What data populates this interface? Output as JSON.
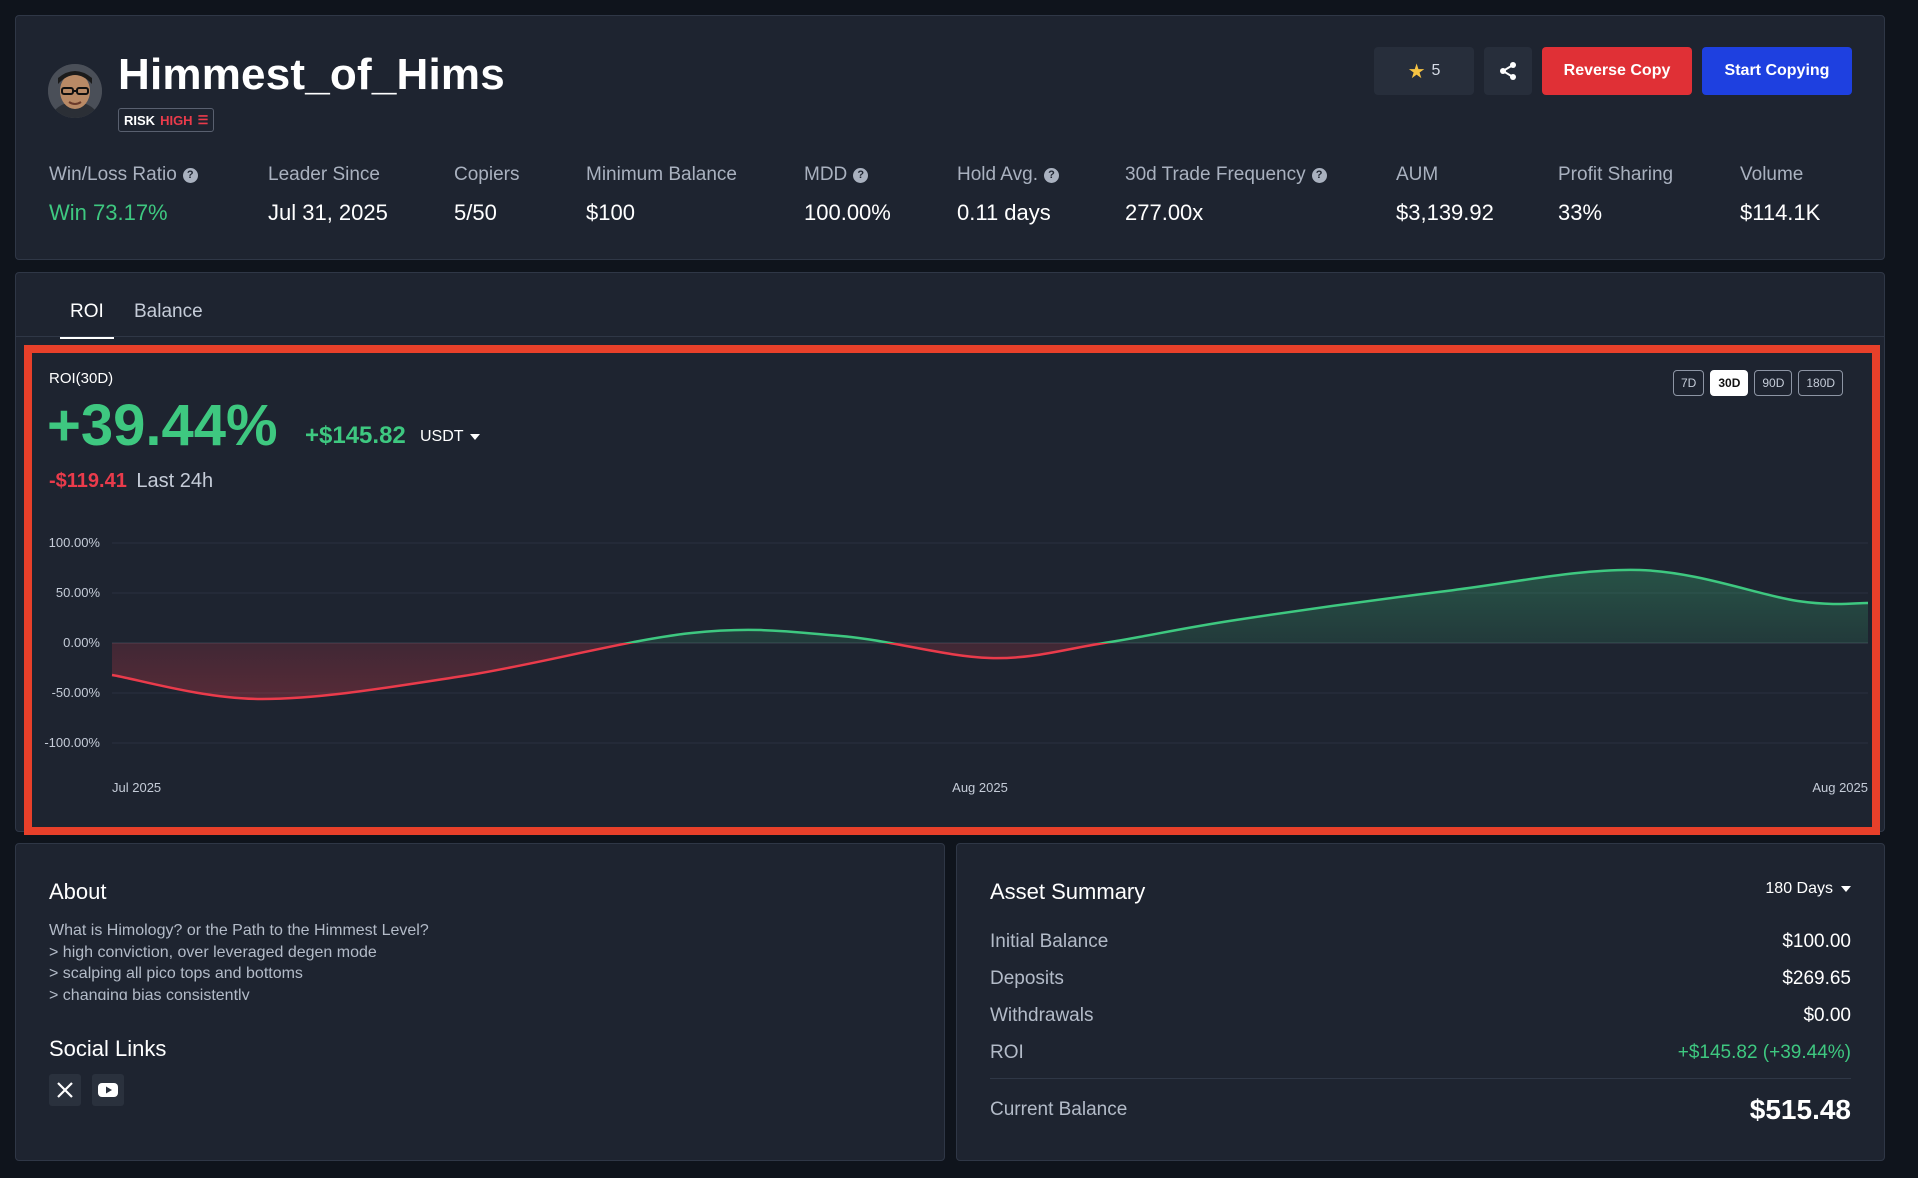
{
  "header": {
    "name": "Himmest_of_Hims",
    "risk_label": "RISK",
    "risk_level": "HIGH",
    "favorites_count": "5",
    "reverse_copy_label": "Reverse Copy",
    "start_copying_label": "Start Copying"
  },
  "stats": [
    {
      "label": "Win/Loss Ratio",
      "value": "Win 73.17%"
    },
    {
      "label": "Leader Since",
      "value": "Jul 31, 2025"
    },
    {
      "label": "Copiers",
      "value": "5/50"
    },
    {
      "label": "Minimum Balance",
      "value": "$100"
    },
    {
      "label": "MDD",
      "value": "100.00%"
    },
    {
      "label": "Hold Avg.",
      "value": "0.11 days"
    },
    {
      "label": "30d Trade Frequency",
      "value": "277.00x"
    },
    {
      "label": "AUM",
      "value": "$3,139.92"
    },
    {
      "label": "Profit Sharing",
      "value": "33%"
    },
    {
      "label": "Volume",
      "value": "$114.1K"
    }
  ],
  "tabs": [
    {
      "label": "ROI",
      "active": true
    },
    {
      "label": "Balance",
      "active": false
    }
  ],
  "roi": {
    "title": "ROI(30D)",
    "percent": "+39.44%",
    "amount": "+$145.82",
    "currency": "USDT",
    "day_change": "-$119.41",
    "day_change_label": "Last 24h",
    "ranges": [
      "7D",
      "30D",
      "90D",
      "180D"
    ],
    "active_range": "30D"
  },
  "chart_data": {
    "type": "area",
    "ylabel": "",
    "xlabel": "",
    "y_ticks": [
      "100.00%",
      "50.00%",
      "0.00%",
      "-50.00%",
      "-100.00%"
    ],
    "ylim": [
      -100,
      100
    ],
    "x_ticks": [
      "Jul 2025",
      "Aug 2025",
      "Aug 2025"
    ],
    "x": [
      0,
      0.085,
      0.2,
      0.33,
      0.415,
      0.5,
      0.565,
      0.64,
      0.76,
      0.87,
      0.96,
      1.0
    ],
    "values": [
      -32,
      -56,
      -33,
      10,
      7,
      -15,
      0,
      23,
      52,
      73,
      42,
      40
    ],
    "positive_color": "#3ec880",
    "negative_color": "#ea3b4b",
    "grid": true
  },
  "about": {
    "title": "About",
    "lines": [
      "What is Himology? or the Path to the Himmest Level?",
      "> high conviction, over leveraged degen mode",
      "> scalping all pico tops and bottoms",
      "> changing bias consistently"
    ],
    "social_title": "Social Links",
    "social_icons": [
      "x-icon",
      "youtube-icon"
    ]
  },
  "asset_summary": {
    "title": "Asset Summary",
    "period": "180 Days",
    "rows": [
      {
        "label": "Initial Balance",
        "value": "$100.00"
      },
      {
        "label": "Deposits",
        "value": "$269.65"
      },
      {
        "label": "Withdrawals",
        "value": "$0.00"
      },
      {
        "label": "ROI",
        "value": "+$145.82 (+39.44%)"
      }
    ],
    "current_label": "Current Balance",
    "current_value": "$515.48"
  }
}
